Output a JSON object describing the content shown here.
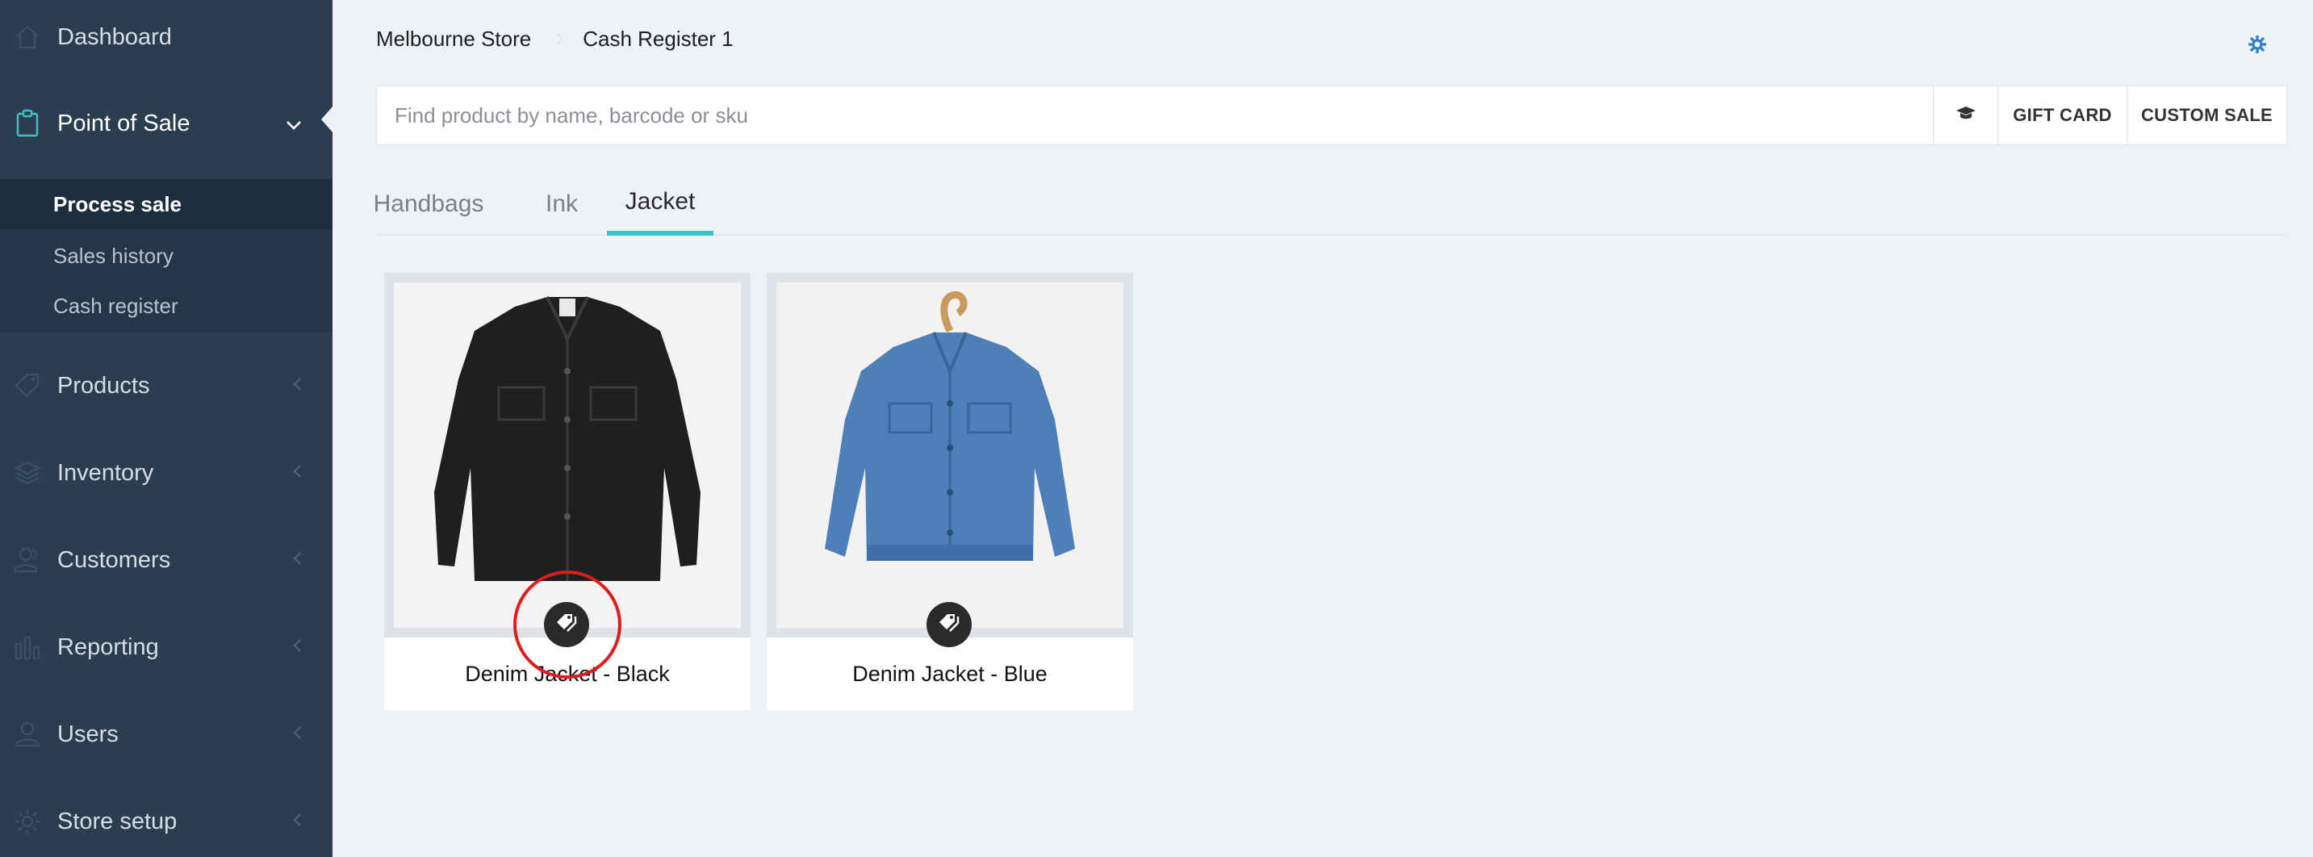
{
  "sidebar": {
    "items": [
      {
        "label": "Dashboard",
        "icon": "home-icon"
      },
      {
        "label": "Point of Sale",
        "icon": "clipboard-icon"
      },
      {
        "label": "Products",
        "icon": "tag-icon"
      },
      {
        "label": "Inventory",
        "icon": "layers-icon"
      },
      {
        "label": "Customers",
        "icon": "customers-icon"
      },
      {
        "label": "Reporting",
        "icon": "bar-chart-icon"
      },
      {
        "label": "Users",
        "icon": "user-icon"
      },
      {
        "label": "Store setup",
        "icon": "gear-icon"
      }
    ],
    "subitems": [
      {
        "label": "Process sale",
        "active": true
      },
      {
        "label": "Sales history",
        "active": false
      },
      {
        "label": "Cash register",
        "active": false
      }
    ]
  },
  "header": {
    "store": "Melbourne Store",
    "register": "Cash Register 1"
  },
  "search": {
    "placeholder": "Find product by name, barcode or sku",
    "value": ""
  },
  "toolbar": {
    "gift_card_label": "GIFT CARD",
    "custom_sale_label": "CUSTOM SALE"
  },
  "tabs": [
    {
      "label": "Handbags",
      "active": false
    },
    {
      "label": "Ink",
      "active": false
    },
    {
      "label": "Jacket",
      "active": true
    }
  ],
  "products": [
    {
      "name": "Denim Jacket - Black",
      "color": "#1f1f21"
    },
    {
      "name": "Denim Jacket - Blue",
      "color": "#4d7fb8"
    }
  ],
  "colors": {
    "sidebar_bg": "#2b3e50",
    "accent": "#3ec1c9",
    "settings_icon": "#2f7fc4",
    "highlight": "#e01b1b"
  }
}
